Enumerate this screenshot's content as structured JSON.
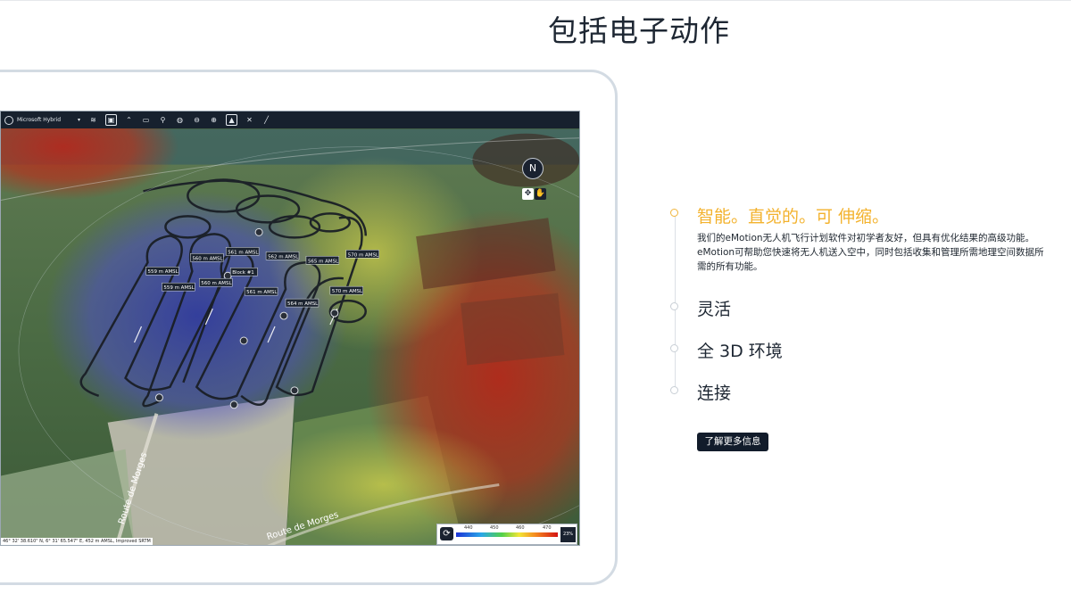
{
  "page": {
    "title": "包括电子动作"
  },
  "map": {
    "layer_selector": "Microsoft Hybrid",
    "dropdown_caret": "▾",
    "toolbar_icons": [
      "layers-icon",
      "cube-icon",
      "terrain-icon",
      "image-icon",
      "pin-icon",
      "eye-slash-icon",
      "zoom-out-icon",
      "zoom-in-icon",
      "warning-icon",
      "drone-off-icon",
      "ruler-icon"
    ],
    "compass_glyph": "N",
    "coordinates": "46° 32' 38.610\" N, 6° 31' 65.547\" E, 452 m AMSL, Improved SRTM",
    "road_labels": [
      "Route de Morges",
      "Route de Morges"
    ],
    "waypoint_labels": [
      "560 m AMSL",
      "561 m AMSL",
      "562 m AMSL",
      "565 m AMSL",
      "570 m AMSL",
      "559 m AMSL",
      "559 m AMSL",
      "560 m AMSL",
      "Block #1",
      "561 m AMSL",
      "564 m AMSL",
      "570 m AMSL"
    ],
    "legend": {
      "ticks": [
        "440",
        "450",
        "460",
        "470"
      ],
      "moon_label": "23%"
    }
  },
  "features": [
    {
      "title": "智能。直觉的。可 伸缩。",
      "description": "我们的eMotion无人机飞行计划软件对初学者友好，但具有优化结果的高级功能。eMotion可帮助您快速将无人机送入空中，同时包括收集和管理所需地理空间数据所需的所有功能。",
      "active": true
    },
    {
      "title": "灵活",
      "active": false
    },
    {
      "title": "全 3D 环境",
      "active": false
    },
    {
      "title": "连接",
      "active": false
    }
  ],
  "cta": {
    "label": "了解更多信息"
  },
  "colors": {
    "accent": "#f3b22d",
    "dark": "#121c2b"
  }
}
